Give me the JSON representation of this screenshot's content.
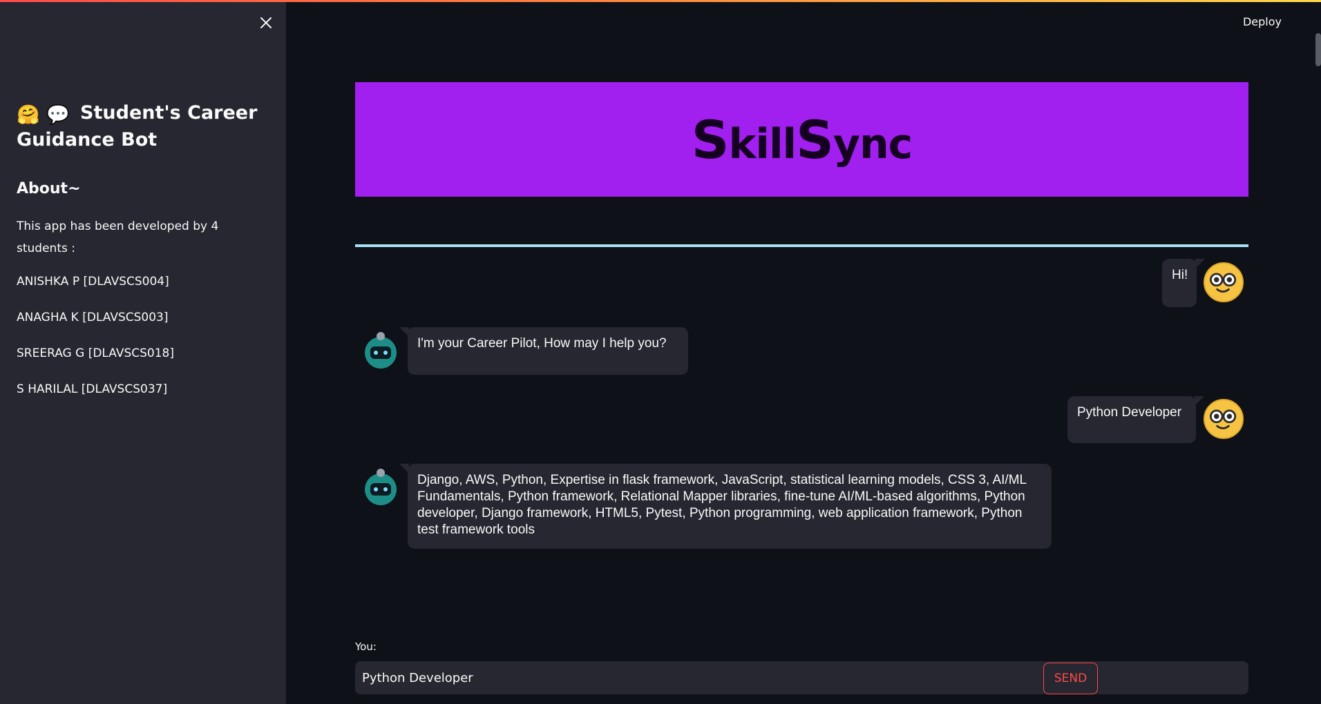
{
  "sidebar": {
    "title": "Student's Career Guidance Bot",
    "title_emojis": "🤗 💬",
    "about_heading": "About~",
    "about_text": "This app has been developed by 4 students :",
    "students": [
      "ANISHKA P [DLAVSCS004]",
      "ANAGHA K [DLAVSCS003]",
      "SREERAG G [DLAVSCS018]",
      "S HARILAL [DLAVSCS037]"
    ]
  },
  "header": {
    "deploy_label": "Deploy"
  },
  "banner": {
    "brand_part1_big": "S",
    "brand_part1_rest": "kill",
    "brand_part2_big": "S",
    "brand_part2_rest": "ync"
  },
  "chat": {
    "messages": [
      {
        "role": "user",
        "text": "Hi!"
      },
      {
        "role": "bot",
        "text": "I'm your Career Pilot, How may I help you?"
      },
      {
        "role": "user",
        "text": "Python Developer"
      },
      {
        "role": "bot",
        "text": "Django, AWS, Python, Expertise in flask framework, JavaScript, statistical learning models, CSS 3, AI/ML Fundamentals, Python framework, Relational Mapper libraries, fine-tune AI/ML-based algorithms, Python developer, Django framework, HTML5, Pytest, Python programming, web application framework, Python test framework tools"
      }
    ]
  },
  "input": {
    "label": "You:",
    "value": "Python Developer",
    "send_label": "SEND"
  },
  "colors": {
    "accent": "#ff4b4b",
    "banner": "#a11fef",
    "divider": "#a8e0f7",
    "sidebar_bg": "#262730",
    "main_bg": "#0e1117"
  }
}
